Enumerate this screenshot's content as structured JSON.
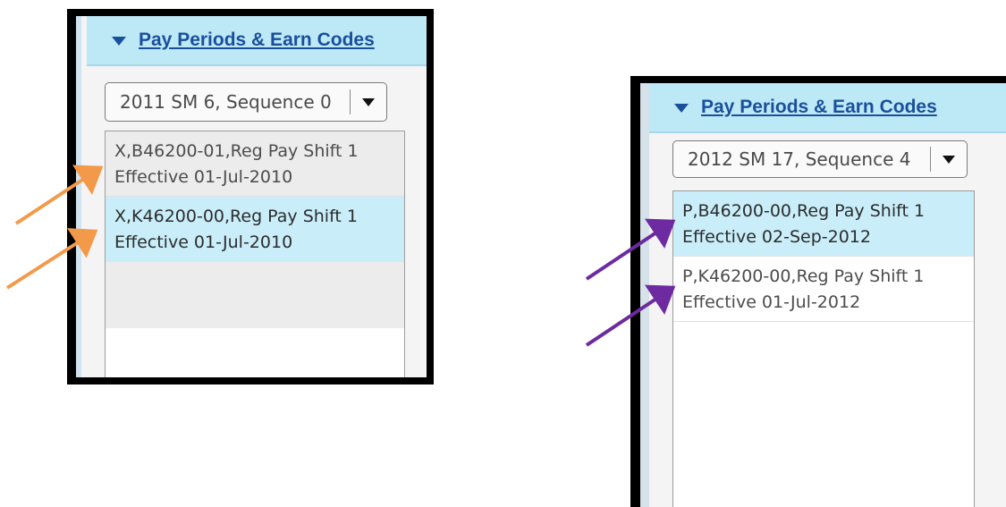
{
  "left_panel": {
    "header": {
      "title": "Pay Periods & Earn Codes"
    },
    "dropdown": {
      "selected": "2011 SM 6, Sequence 0"
    },
    "items": [
      {
        "line1": "X,B46200-01,Reg Pay Shift 1",
        "line2": "Effective 01-Jul-2010",
        "selected": false
      },
      {
        "line1": "X,K46200-00,Reg Pay Shift 1",
        "line2": "Effective 01-Jul-2010",
        "selected": true
      }
    ]
  },
  "right_panel": {
    "header": {
      "title": "Pay Periods & Earn Codes"
    },
    "dropdown": {
      "selected": "2012 SM 17, Sequence 4"
    },
    "items": [
      {
        "line1": "P,B46200-00,Reg Pay Shift 1",
        "line2": "Effective 02-Sep-2012",
        "selected": true
      },
      {
        "line1": "P,K46200-00,Reg Pay Shift 1",
        "line2": "Effective 01-Jul-2012",
        "selected": false
      }
    ]
  },
  "colors": {
    "header_bg": "#bde9f7",
    "link": "#1a4f9c",
    "selected_row": "#c9eefa",
    "annotation_orange": "#f39a4a",
    "annotation_purple": "#6e2aa0"
  }
}
